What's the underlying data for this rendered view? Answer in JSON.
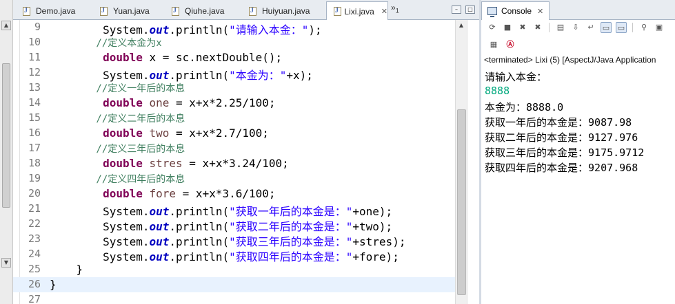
{
  "editor": {
    "tabs": [
      {
        "label": "Demo.java",
        "active": false
      },
      {
        "label": "Yuan.java",
        "active": false
      },
      {
        "label": "Qiuhe.java",
        "active": false
      },
      {
        "label": "Huiyuan.java",
        "active": false
      },
      {
        "label": "Lixi.java",
        "active": true
      }
    ],
    "close_glyph": "✕",
    "overflow_label": "»",
    "overflow_count": "1",
    "lines": [
      {
        "n": "9",
        "parts": [
          [
            "",
            "        System."
          ],
          [
            "fld",
            "out"
          ],
          [
            "",
            ".println("
          ],
          [
            "str",
            "\"请输入本金：\""
          ],
          [
            "",
            ");"
          ]
        ]
      },
      {
        "n": "10",
        "parts": [
          [
            "cmt",
            "        //定义本金为x"
          ]
        ]
      },
      {
        "n": "11",
        "parts": [
          [
            "kw",
            "        double"
          ],
          [
            "",
            " x = sc.nextDouble();"
          ]
        ]
      },
      {
        "n": "12",
        "parts": [
          [
            "",
            "        System."
          ],
          [
            "fld",
            "out"
          ],
          [
            "",
            ".println("
          ],
          [
            "str",
            "\"本金为：\""
          ],
          [
            "",
            "+x);"
          ]
        ]
      },
      {
        "n": "13",
        "parts": [
          [
            "cmt",
            "        //定义一年后的本息"
          ]
        ]
      },
      {
        "n": "14",
        "parts": [
          [
            "kw",
            "        double"
          ],
          [
            "lvar",
            " one"
          ],
          [
            "",
            " = x+x*2.25/100;"
          ]
        ]
      },
      {
        "n": "15",
        "parts": [
          [
            "cmt",
            "        //定义二年后的本息"
          ]
        ]
      },
      {
        "n": "16",
        "parts": [
          [
            "kw",
            "        double"
          ],
          [
            "lvar",
            " two"
          ],
          [
            "",
            " = x+x*2.7/100;"
          ]
        ]
      },
      {
        "n": "17",
        "parts": [
          [
            "cmt",
            "        //定义三年后的本息"
          ]
        ]
      },
      {
        "n": "18",
        "parts": [
          [
            "kw",
            "        double"
          ],
          [
            "lvar",
            " stres"
          ],
          [
            "",
            " = x+x*3.24/100;"
          ]
        ]
      },
      {
        "n": "19",
        "parts": [
          [
            "cmt",
            "        //定义四年后的本息"
          ]
        ]
      },
      {
        "n": "20",
        "parts": [
          [
            "kw",
            "        double"
          ],
          [
            "lvar",
            " fore"
          ],
          [
            "",
            " = x+x*3.6/100;"
          ]
        ]
      },
      {
        "n": "21",
        "parts": [
          [
            "",
            "        System."
          ],
          [
            "fld",
            "out"
          ],
          [
            "",
            ".println("
          ],
          [
            "str",
            "\"获取一年后的本金是：\""
          ],
          [
            "",
            "+one);"
          ]
        ]
      },
      {
        "n": "22",
        "parts": [
          [
            "",
            "        System."
          ],
          [
            "fld",
            "out"
          ],
          [
            "",
            ".println("
          ],
          [
            "str",
            "\"获取二年后的本金是：\""
          ],
          [
            "",
            "+two);"
          ]
        ]
      },
      {
        "n": "23",
        "parts": [
          [
            "",
            "        System."
          ],
          [
            "fld",
            "out"
          ],
          [
            "",
            ".println("
          ],
          [
            "str",
            "\"获取三年后的本金是：\""
          ],
          [
            "",
            "+stres);"
          ]
        ]
      },
      {
        "n": "24",
        "parts": [
          [
            "",
            "        System."
          ],
          [
            "fld",
            "out"
          ],
          [
            "",
            ".println("
          ],
          [
            "str",
            "\"获取四年后的本金是：\""
          ],
          [
            "",
            "+fore);"
          ]
        ]
      },
      {
        "n": "25",
        "parts": [
          [
            "",
            "    }"
          ]
        ]
      },
      {
        "n": "26",
        "parts": [
          [
            "",
            "}"
          ]
        ],
        "current": true
      },
      {
        "n": "27",
        "parts": [
          [
            "",
            ""
          ]
        ]
      }
    ]
  },
  "console": {
    "tab_label": "Console",
    "close_glyph": "✕",
    "terminated": "<terminated> Lixi (5) [AspectJ/Java Application",
    "output": [
      {
        "text": "请输入本金：",
        "input": false
      },
      {
        "text": "8888",
        "input": true
      },
      {
        "text": "本金为：8888.0",
        "input": false
      },
      {
        "text": "获取一年后的本金是：9087.98",
        "input": false
      },
      {
        "text": "获取二年后的本金是：9127.976",
        "input": false
      },
      {
        "text": "获取三年后的本金是：9175.9712",
        "input": false
      },
      {
        "text": "获取四年后的本金是：9207.968",
        "input": false
      }
    ]
  }
}
